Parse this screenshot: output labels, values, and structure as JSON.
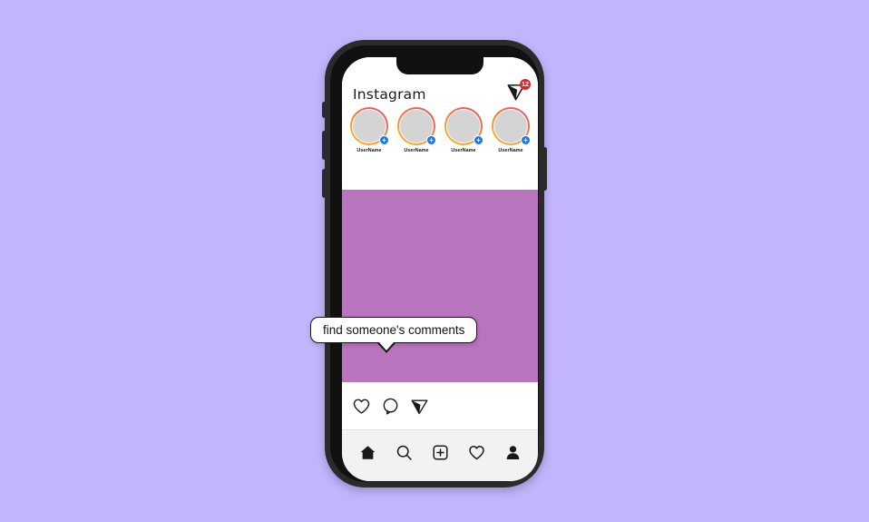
{
  "page": {
    "background_color": "#c3b5fd",
    "device": "smartphone-mockup"
  },
  "app": {
    "name": "Instagram",
    "wordmark": "Instagram"
  },
  "header": {
    "title": "Instagram",
    "direct_message_icon": "paper-plane-icon",
    "badge_count": "12",
    "badge_color": "#e2222b"
  },
  "stories": {
    "items": [
      {
        "label": "UserName",
        "has_add_badge": true,
        "add_badge_symbol": "+"
      },
      {
        "label": "UserName",
        "has_add_badge": true,
        "add_badge_symbol": "+"
      },
      {
        "label": "UserName",
        "has_add_badge": true,
        "add_badge_symbol": "+"
      },
      {
        "label": "UserName",
        "has_add_badge": true,
        "add_badge_symbol": "+"
      }
    ],
    "ring_gradient_start": "#f9a825",
    "ring_gradient_end": "#ef5a5f",
    "avatar_fill": "#d4d4d4",
    "badge_color": "#1877f2"
  },
  "post": {
    "image_color": "#b875bd",
    "actions": [
      {
        "name": "like",
        "icon": "heart-icon"
      },
      {
        "name": "comment",
        "icon": "comment-bubble-icon"
      },
      {
        "name": "share",
        "icon": "paper-plane-icon"
      }
    ]
  },
  "bottom_nav": {
    "items": [
      {
        "name": "home",
        "icon": "home-icon"
      },
      {
        "name": "search",
        "icon": "search-icon"
      },
      {
        "name": "create",
        "icon": "plus-square-icon"
      },
      {
        "name": "activity",
        "icon": "heart-icon"
      },
      {
        "name": "profile",
        "icon": "person-icon"
      }
    ]
  },
  "tooltip": {
    "text": "find someone's comments",
    "points_to": "comment-bubble-icon"
  }
}
